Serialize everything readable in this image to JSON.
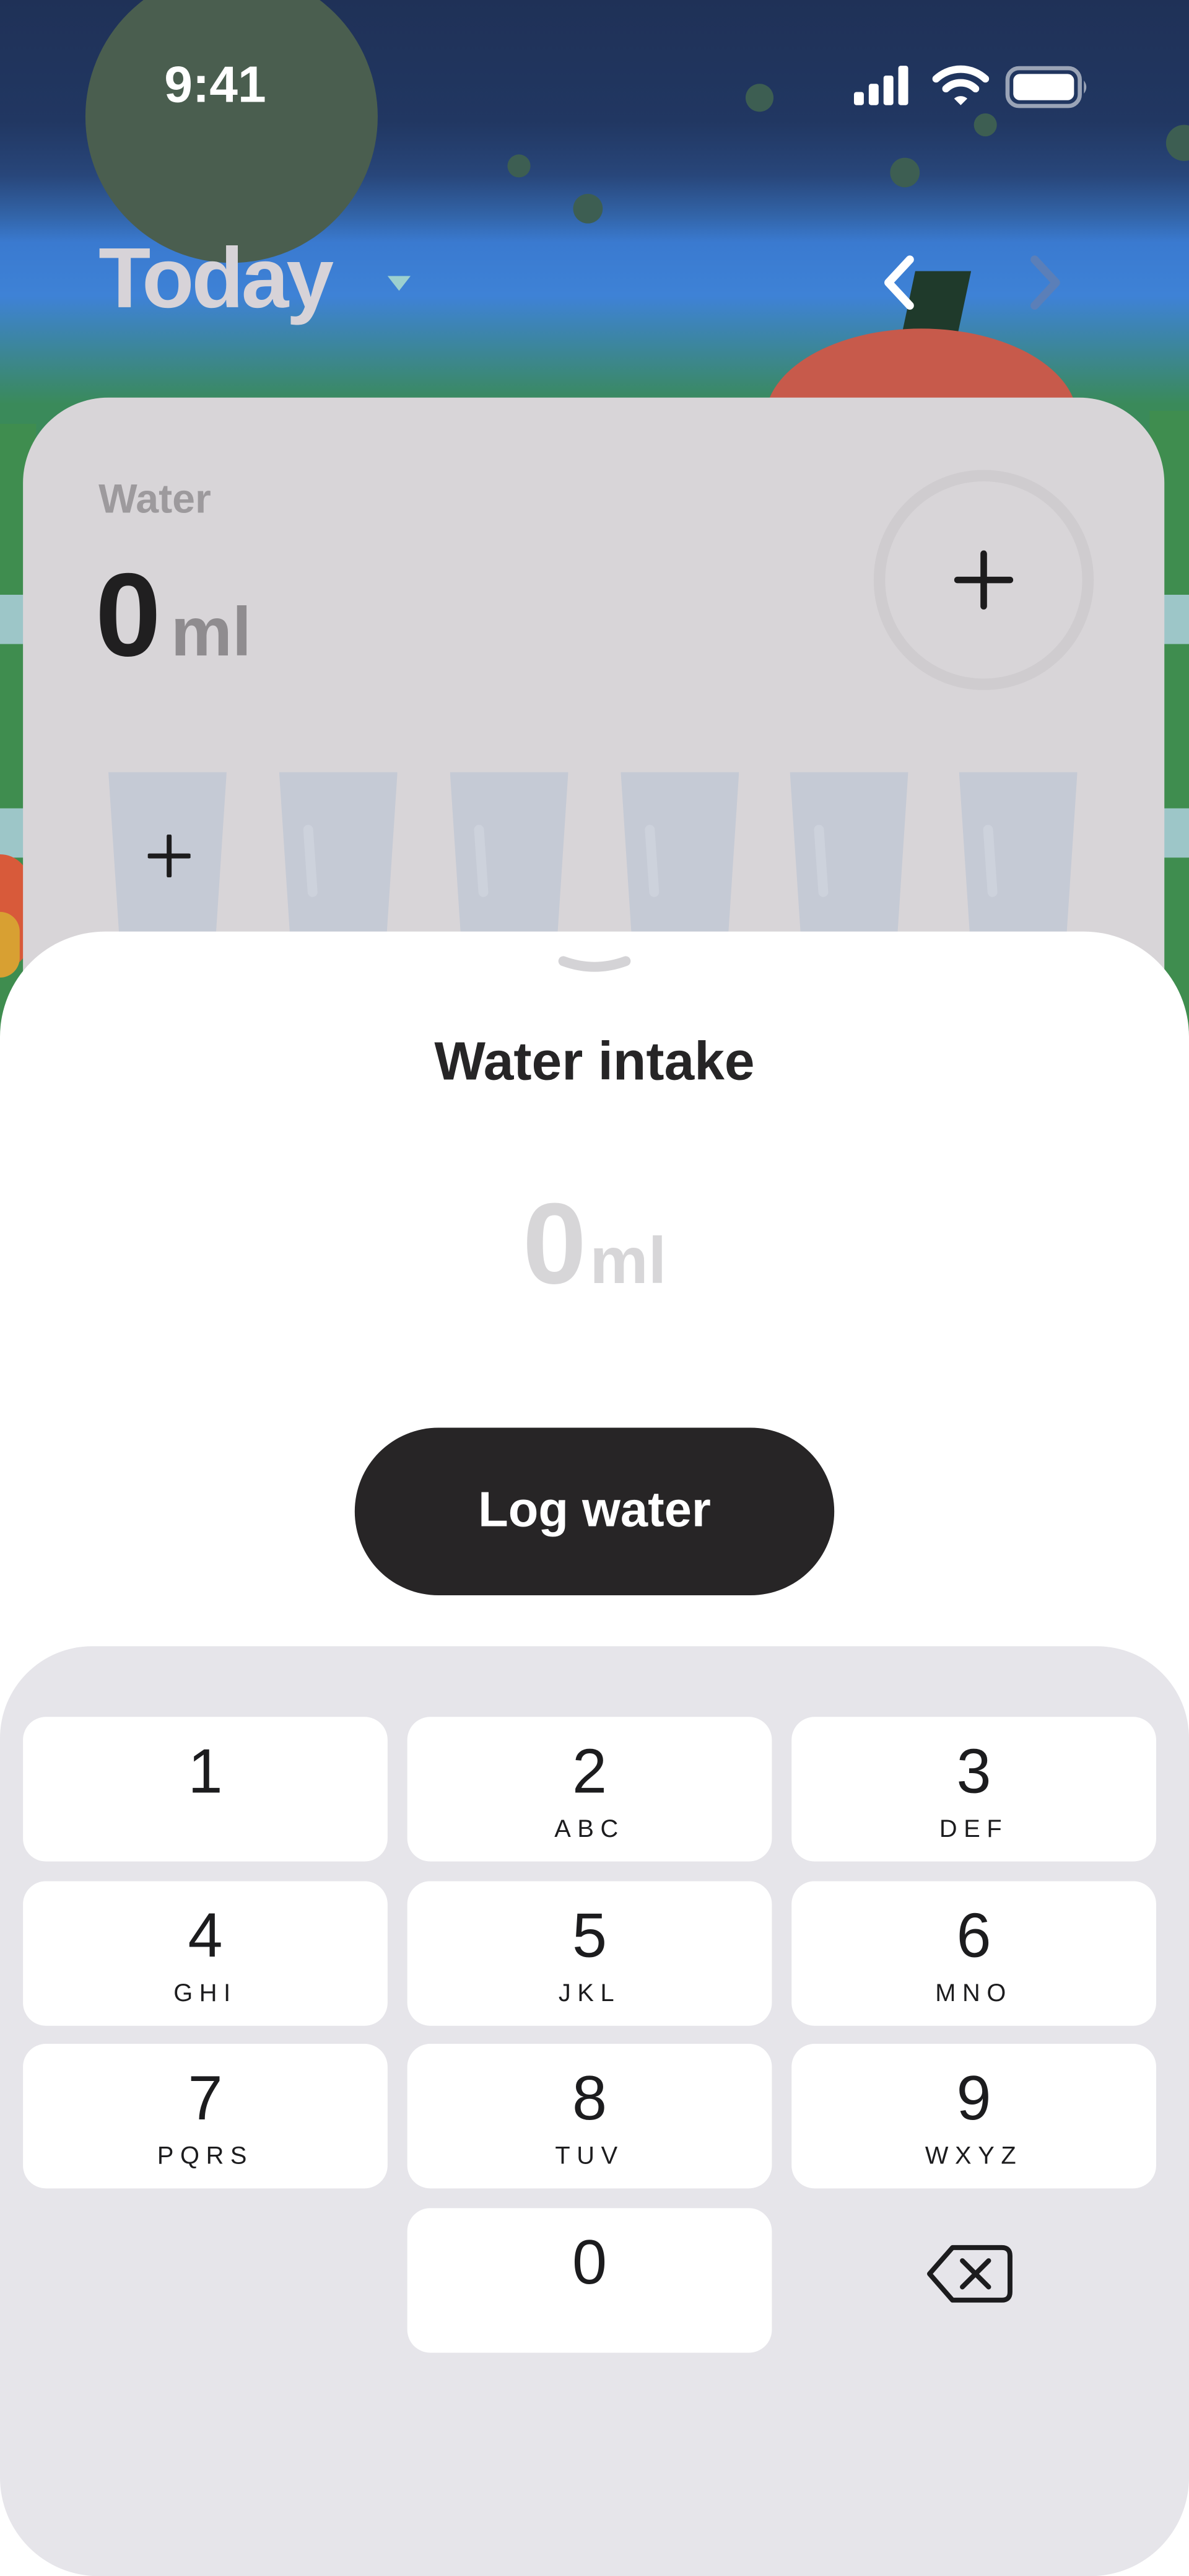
{
  "status_bar": {
    "time": "9:41"
  },
  "header": {
    "title": "Today",
    "caret_icon": "caret-down-icon",
    "prev_icon": "chevron-left-icon",
    "next_icon": "chevron-right-icon"
  },
  "water_card": {
    "label": "Water",
    "amount": "0",
    "unit": "ml",
    "add_icon": "plus-icon",
    "glasses_count": 6
  },
  "sheet": {
    "title": "Water intake",
    "amount": "0",
    "unit": "ml",
    "button_label": "Log water"
  },
  "keypad": {
    "keys": [
      {
        "digit": "1",
        "letters": ""
      },
      {
        "digit": "2",
        "letters": "ABC"
      },
      {
        "digit": "3",
        "letters": "DEF"
      },
      {
        "digit": "4",
        "letters": "GHI"
      },
      {
        "digit": "5",
        "letters": "JKL"
      },
      {
        "digit": "6",
        "letters": "MNO"
      },
      {
        "digit": "7",
        "letters": "PQRS"
      },
      {
        "digit": "8",
        "letters": "TUV"
      },
      {
        "digit": "9",
        "letters": "WXYZ"
      },
      {
        "digit": "0",
        "letters": ""
      }
    ],
    "delete_icon": "backspace-icon"
  },
  "colors": {
    "sky_dark": "#1f3157",
    "sky_blue": "#3e82d6",
    "grass": "#3d8f55",
    "card": "#d8d5d8",
    "button_dark": "#272526",
    "keypad_bg": "#e6e5ea"
  }
}
